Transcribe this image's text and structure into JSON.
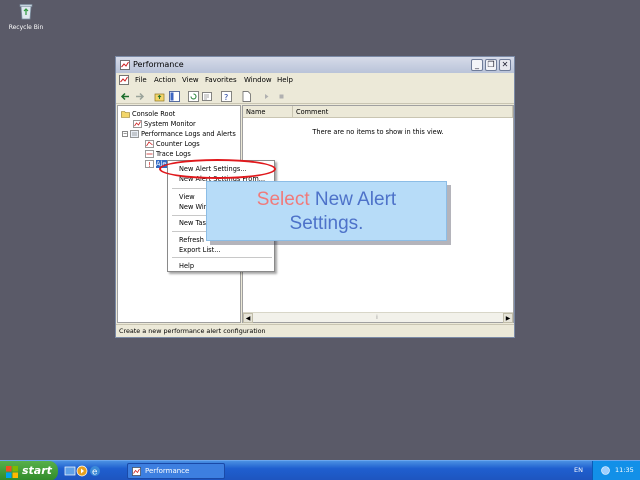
{
  "desktop": {
    "recycle_bin_label": "Recycle Bin"
  },
  "window": {
    "title": "Performance",
    "menu": [
      "File",
      "Action",
      "View",
      "Favorites",
      "Window",
      "Help"
    ],
    "tree": {
      "root": "Console Root",
      "system_monitor": "System Monitor",
      "perf_logs": "Performance Logs and Alerts",
      "counter_logs": "Counter Logs",
      "trace_logs": "Trace Logs",
      "alerts": "Alerts"
    },
    "list": {
      "col_name": "Name",
      "col_comment": "Comment",
      "empty_text": "There are no items to show in this view."
    },
    "status": "Create a new performance alert configuration"
  },
  "context_menu": {
    "new_alert_settings": "New Alert Settings...",
    "new_alert_from": "New Alert Settings From...",
    "view": "View",
    "new_window": "New Window from Here",
    "new_taskpad": "New Taskpad View...",
    "refresh": "Refresh",
    "export": "Export List...",
    "help": "Help"
  },
  "callout": {
    "verb": "Select",
    "target_line1": "New Alert",
    "target_line2": "Settings."
  },
  "taskbar": {
    "start_label": "start",
    "task_label": "Performance",
    "language": "EN",
    "clock": "11:35"
  },
  "colors": {
    "highlight_ring": "#e0181c",
    "callout_bg": "#b7dcf8",
    "verb_color": "#f07a7a",
    "target_color": "#4d72c9"
  }
}
